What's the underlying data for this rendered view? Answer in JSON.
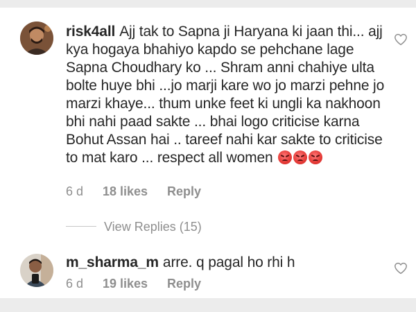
{
  "comments": [
    {
      "username": "risk4all",
      "text": "Ajj tak to Sapna ji Haryana ki jaan thi... ajj kya hogaya bhahiyo kapdo se pehchane lage Sapna Choudhary ko ... Shram anni chahiye ulta bolte huye bhi ...jo marji kare wo jo marzi pehne jo marzi khaye... thum unke feet ki ungli ka nakhoon bhi nahi paad sakte ... bhai logo criticise karna Bohut Assan hai .. tareef nahi kar sakte to criticise to mat karo ... respect all women",
      "emojis": [
        "angry-face",
        "angry-face",
        "angry-face"
      ],
      "time": "6 d",
      "likes": "18 likes",
      "reply_label": "Reply",
      "view_replies": "View Replies (15)"
    },
    {
      "username": "m_sharma_m",
      "text": "arre. q pagal ho rhi h",
      "time": "6 d",
      "likes": "19 likes",
      "reply_label": "Reply"
    }
  ],
  "icons": {
    "like": "heart-outline-icon",
    "reaction": "angry-face-emoji"
  },
  "colors": {
    "text": "#262626",
    "secondary": "#8e8e8e",
    "background": "#ffffff",
    "emoji": "#e53935"
  }
}
